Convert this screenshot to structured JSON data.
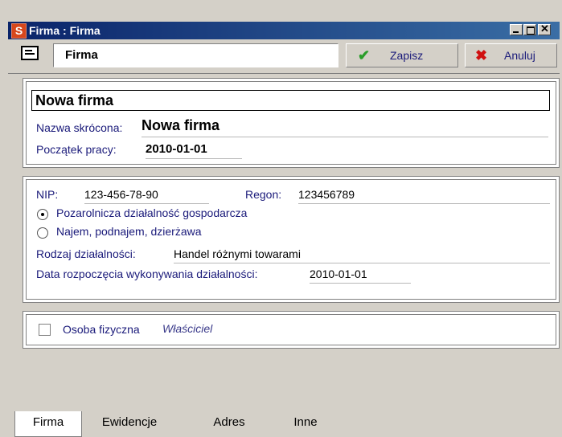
{
  "window": {
    "app_icon": "S",
    "title": "Firma : Firma"
  },
  "toolbar": {
    "record_icon": "form-icon",
    "record_name": "Firma",
    "save_label": "Zapisz",
    "cancel_label": "Anuluj"
  },
  "company": {
    "full_name": "Nowa firma",
    "short_name_label": "Nazwa skrócona:",
    "short_name": "Nowa firma",
    "start_label": "Początek pracy:",
    "start_date": "2010-01-01"
  },
  "tax": {
    "nip_label": "NIP:",
    "nip": "123-456-78-90",
    "regon_label": "Regon:",
    "regon": "123456789",
    "radio_options": [
      {
        "label": "Pozarolnicza działalność gospodarcza",
        "selected": true
      },
      {
        "label": "Najem, podnajem, dzierżawa",
        "selected": false
      }
    ],
    "activity_label": "Rodzaj działalności:",
    "activity": "Handel różnymi towarami",
    "activity_start_label": "Data rozpoczęcia wykonywania działalności:",
    "activity_start": "2010-01-01"
  },
  "person": {
    "checkbox_label": "Osoba fizyczna",
    "owner_label": "Właściciel",
    "checked": false
  },
  "tabs": [
    "Firma",
    "Ewidencje",
    "Adres",
    "Inne"
  ],
  "active_tab": "Firma"
}
